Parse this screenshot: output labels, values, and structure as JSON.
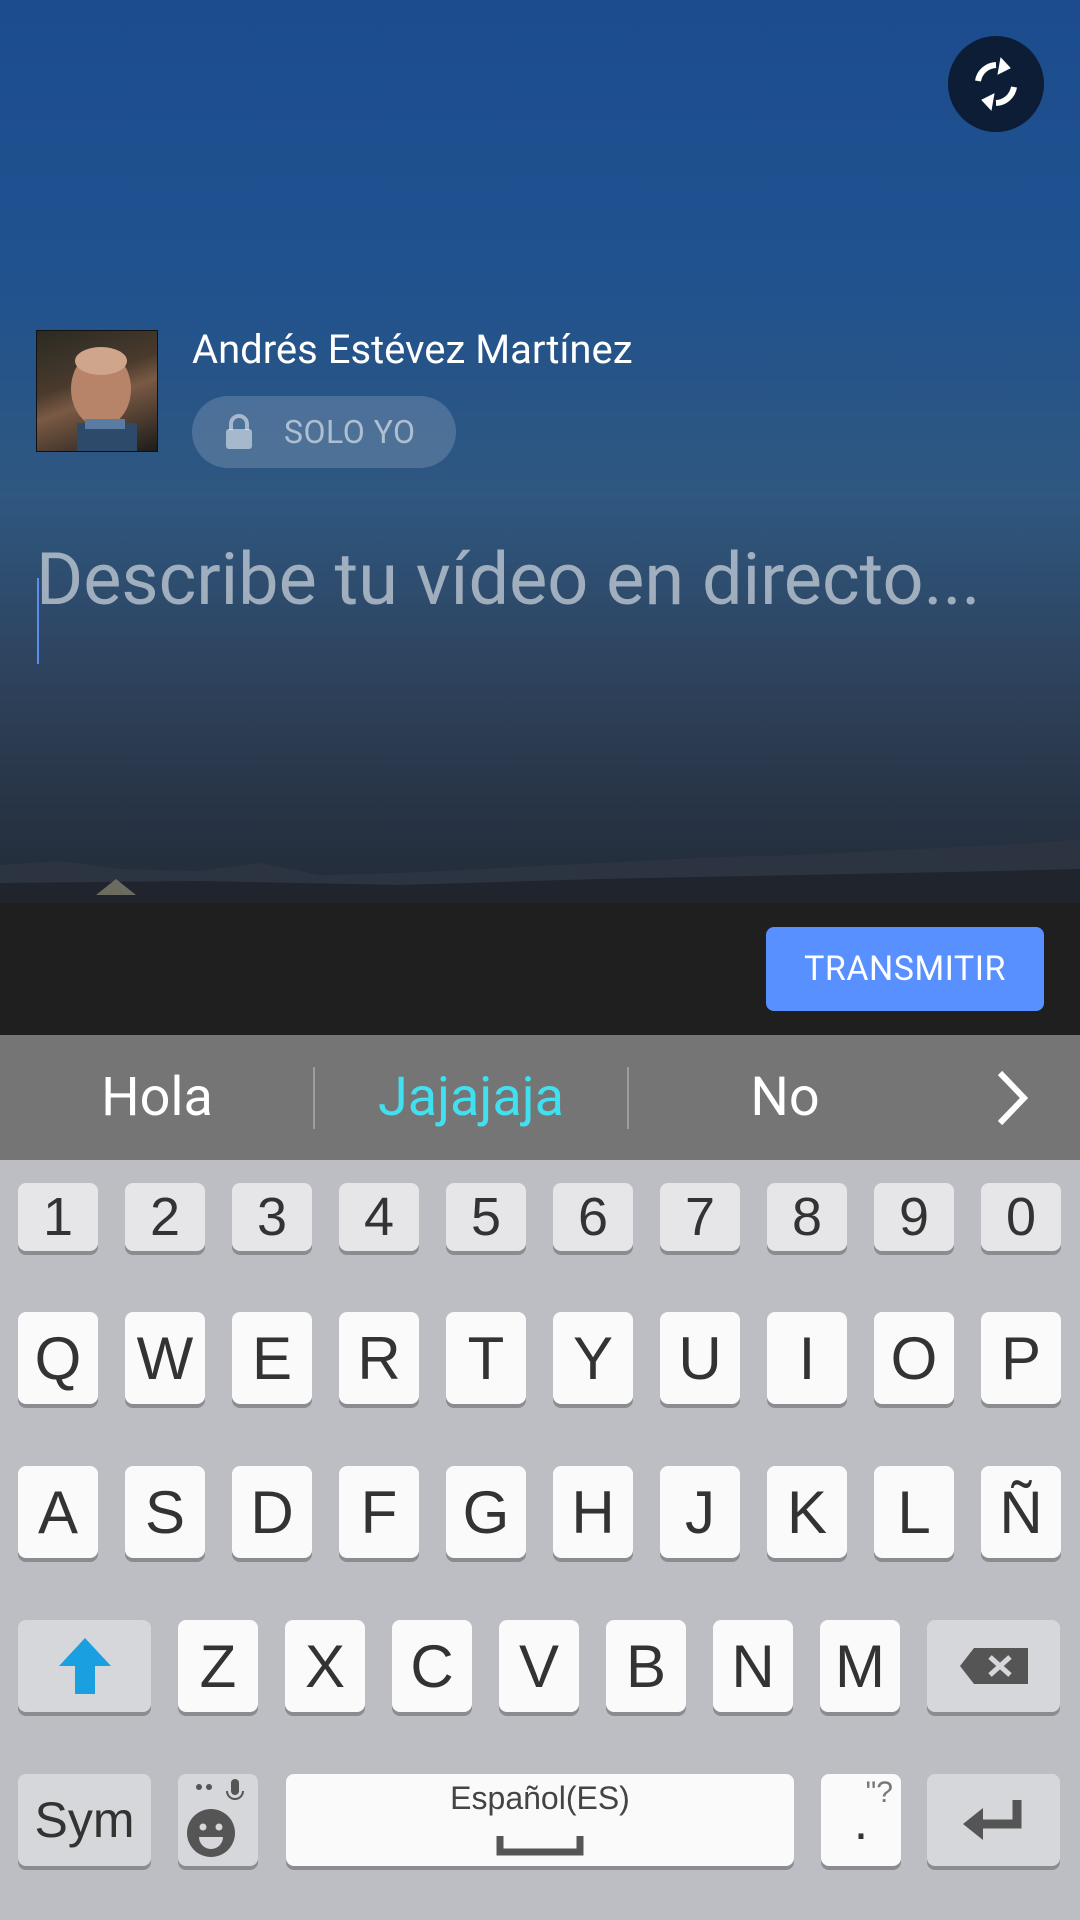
{
  "header": {
    "user_name": "Andrés Estévez Martínez",
    "privacy_label": "SOLO YO",
    "description_placeholder": "Describe tu vídeo en directo...",
    "go_live_label": "TRANSMITIR"
  },
  "icons": {
    "flip_camera": "flip-camera-icon",
    "lock": "lock-icon"
  },
  "colors": {
    "go_live_button": "#5890ff",
    "suggestion_highlight": "#40e0f0",
    "shift_arrow": "#1a9fe0"
  },
  "suggestions": [
    "Hola",
    "Jajajaja",
    "No"
  ],
  "suggestions_highlighted_index": 1,
  "keyboard": {
    "row_numbers": [
      "1",
      "2",
      "3",
      "4",
      "5",
      "6",
      "7",
      "8",
      "9",
      "0"
    ],
    "row1": [
      "Q",
      "W",
      "E",
      "R",
      "T",
      "Y",
      "U",
      "I",
      "O",
      "P"
    ],
    "row2": [
      "A",
      "S",
      "D",
      "F",
      "G",
      "H",
      "J",
      "K",
      "L",
      "Ñ"
    ],
    "row3": [
      "Z",
      "X",
      "C",
      "V",
      "B",
      "N",
      "M"
    ],
    "sym_label": "Sym",
    "space_label": "Español(ES)",
    "punct_label": ".",
    "punct_hint": "\"?"
  }
}
